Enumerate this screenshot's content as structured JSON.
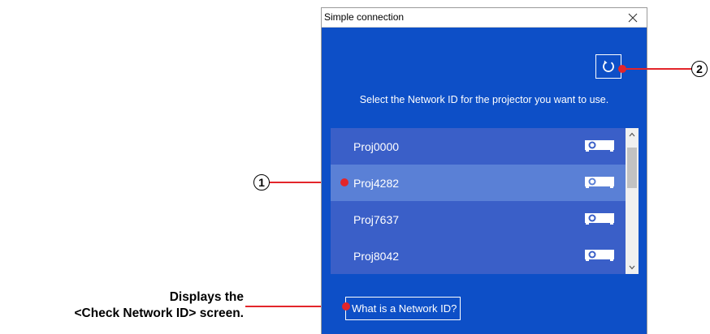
{
  "window": {
    "title": "Simple connection"
  },
  "instruction": "Select the Network ID for the projector you want to use.",
  "projectors": [
    {
      "label": "Proj0000",
      "selected": false
    },
    {
      "label": "Proj4282",
      "selected": true
    },
    {
      "label": "Proj7637",
      "selected": false
    },
    {
      "label": "Proj8042",
      "selected": false
    }
  ],
  "help_link": "What is a Network ID?",
  "callouts": {
    "one": "1",
    "two": "2"
  },
  "caption": {
    "line1": "Displays the",
    "line2": "<Check Network ID> screen."
  },
  "colors": {
    "window_bg": "#0d4fc7",
    "list_bg": "#3a5fc8",
    "selected_bg": "#5a80d6",
    "callout": "#e3252a"
  }
}
